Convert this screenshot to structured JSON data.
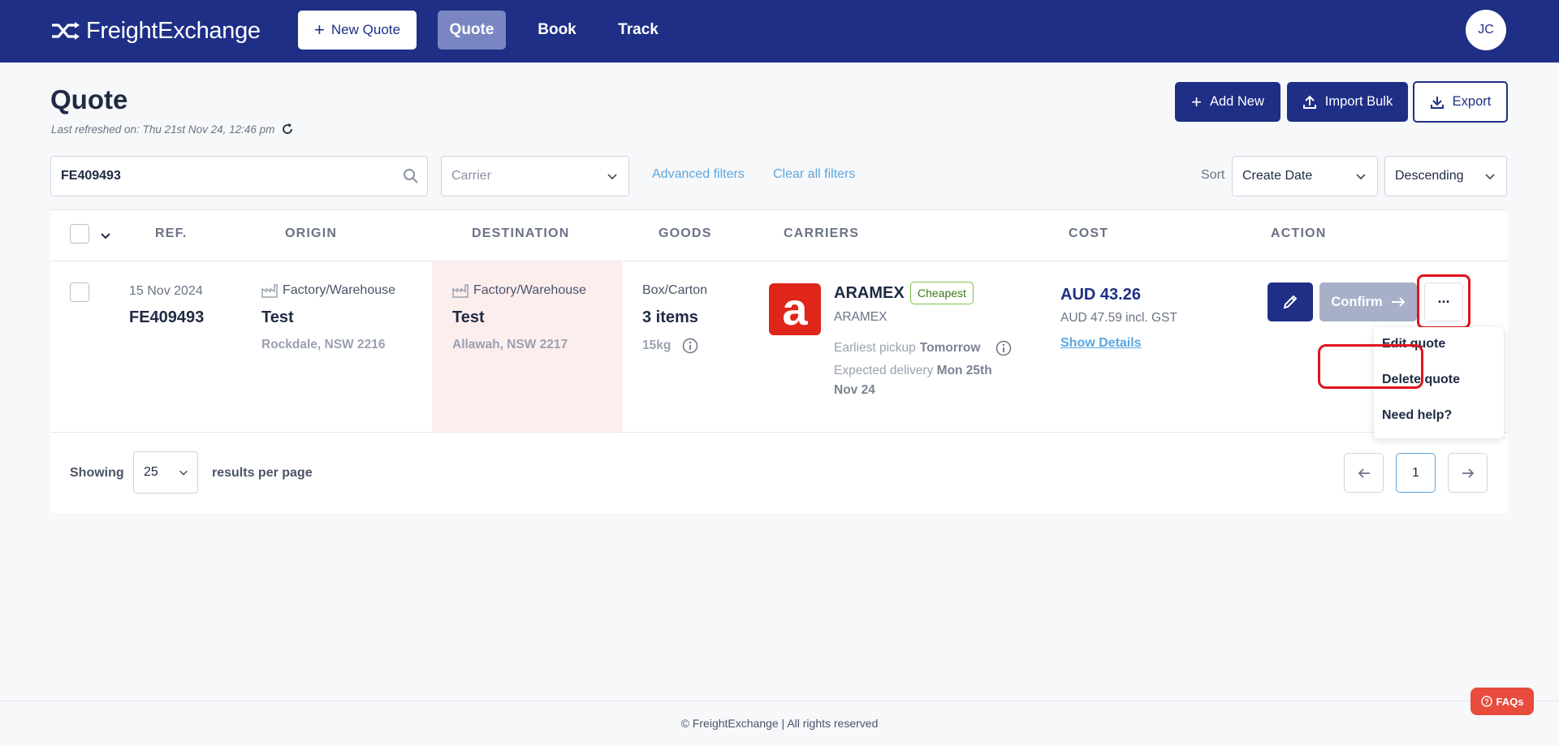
{
  "app": {
    "name": "FreightExchange",
    "user_initials": "JC",
    "brand_color": "#1f2f86"
  },
  "nav": {
    "new_quote": "New Quote",
    "tabs": [
      {
        "label": "Quote",
        "active": true
      },
      {
        "label": "Book"
      },
      {
        "label": "Track"
      }
    ]
  },
  "header": {
    "title": "Quote",
    "last_refreshed": "Last refreshed on: Thu 21st Nov 24, 12:46 pm",
    "add_new": "Add New",
    "import_bulk": "Import Bulk",
    "export": "Export"
  },
  "filters": {
    "search_value": "FE409493",
    "carrier_placeholder": "Carrier",
    "advanced": "Advanced filters",
    "clear": "Clear all filters",
    "sort_label": "Sort",
    "sort_by": "Create Date",
    "sort_order": "Descending"
  },
  "table": {
    "columns": [
      "REF.",
      "ORIGIN",
      "DESTINATION",
      "GOODS",
      "CARRIERS",
      "COST",
      "ACTION"
    ],
    "rows": [
      {
        "date": "15 Nov 2024",
        "ref": "FE409493",
        "origin": {
          "type": "Factory/Warehouse",
          "name": "Test",
          "location": "Rockdale, NSW 2216"
        },
        "destination": {
          "type": "Factory/Warehouse",
          "name": "Test",
          "location": "Allawah, NSW 2217"
        },
        "goods": {
          "type": "Box/Carton",
          "items": "3 items",
          "weight": "15kg"
        },
        "carrier": {
          "name": "ARAMEX",
          "service": "ARAMEX",
          "badge": "Cheapest",
          "pickup_prefix": "Earliest pickup",
          "pickup_value": "Tomorrow",
          "delivery_prefix": "Expected delivery",
          "delivery_value_1": "Mon 25th",
          "delivery_value_2": "Nov 24"
        },
        "cost": {
          "main": "AUD 43.26",
          "incl_gst": "AUD 47.59 incl. GST",
          "details_link": "Show Details"
        },
        "actions": {
          "confirm": "Confirm",
          "more": "···"
        }
      }
    ]
  },
  "action_menu": {
    "items": [
      "Edit quote",
      "Delete quote",
      "Need help?"
    ]
  },
  "pagination": {
    "showing": "Showing",
    "per_page": "25",
    "per_page_label": "results per page",
    "current_page": "1"
  },
  "footer": {
    "copyright": "© FreightExchange | All rights reserved",
    "faqs": "FAQs"
  }
}
